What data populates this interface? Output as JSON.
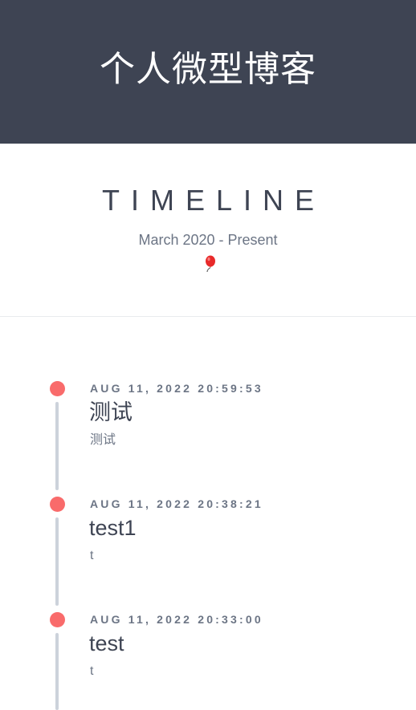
{
  "header": {
    "site_title": "个人微型博客",
    "background_color": "#3e4453"
  },
  "intro": {
    "heading": "TIMELINE",
    "date_range": "March 2020 - Present",
    "decoration_icon": "red-balloon-icon"
  },
  "timeline": {
    "dot_color": "#f96b6b",
    "line_color": "#ccd2db",
    "entries": [
      {
        "date": "AUG 11, 2022 20:59:53",
        "title": "测试",
        "excerpt": "测试"
      },
      {
        "date": "AUG 11, 2022 20:38:21",
        "title": "test1",
        "excerpt": "t"
      },
      {
        "date": "AUG 11, 2022 20:33:00",
        "title": "test",
        "excerpt": "t"
      }
    ]
  }
}
